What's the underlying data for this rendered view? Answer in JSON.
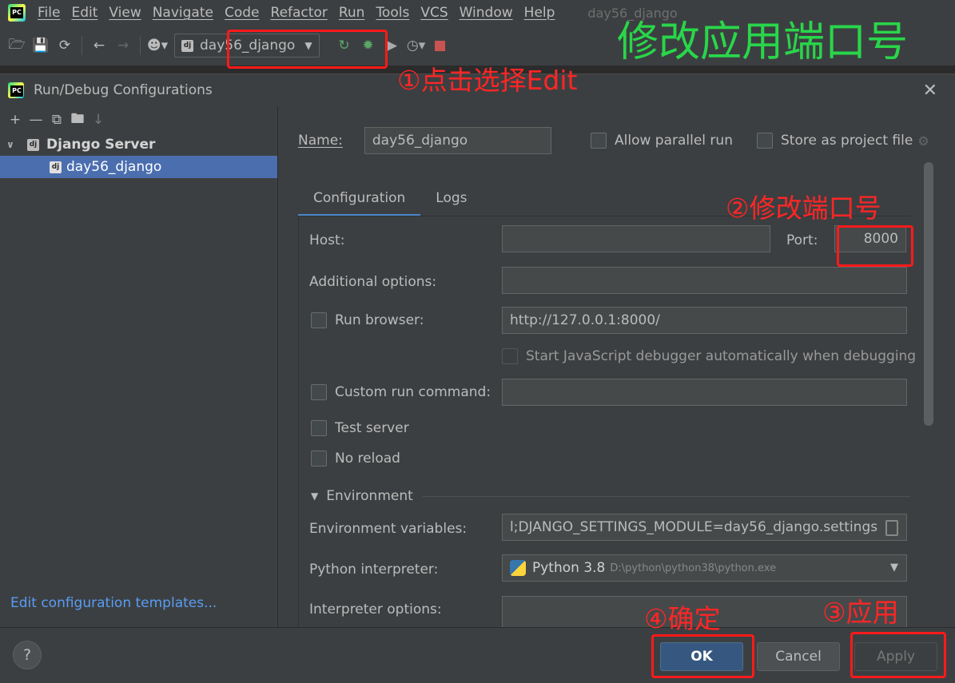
{
  "ide": {
    "menu": [
      "File",
      "Edit",
      "View",
      "Navigate",
      "Code",
      "Refactor",
      "Run",
      "Tools",
      "VCS",
      "Window",
      "Help"
    ],
    "window_title": "day56_django",
    "run_config_name": "day56_django"
  },
  "annotations": {
    "headline": "修改应用端口号",
    "step1": "①点击选择Edit",
    "step2": "②修改端口号",
    "step3": "③应用",
    "step4": "④确定",
    "color": "#ff1a1a",
    "headline_color": "#29d64a"
  },
  "dialog": {
    "title": "Run/Debug Configurations",
    "tree": {
      "group_label": "Django Server",
      "item_label": "day56_django"
    },
    "templates_link": "Edit configuration templates...",
    "name_label": "Name:",
    "name_value": "day56_django",
    "allow_parallel": "Allow parallel run",
    "store_as_project_file": "Store as project file",
    "tabs": [
      "Configuration",
      "Logs"
    ],
    "host_label": "Host:",
    "host_value": "",
    "port_label": "Port:",
    "port_value": "8000",
    "additional_options_label": "Additional options:",
    "additional_options_value": "",
    "run_browser_label": "Run browser:",
    "run_browser_url": "http://127.0.0.1:8000/",
    "js_debugger_label": "Start JavaScript debugger automatically when debugging",
    "custom_run_command_label": "Custom run command:",
    "custom_run_command_value": "",
    "test_server_label": "Test server",
    "no_reload_label": "No reload",
    "environment_label": "Environment",
    "env_vars_label": "Environment variables:",
    "env_vars_value": "l;DJANGO_SETTINGS_MODULE=day56_django.settings",
    "interpreter_label": "Python interpreter:",
    "interpreter_name": "Python 3.8",
    "interpreter_path": "D:\\python\\python38\\python.exe",
    "interpreter_options_label": "Interpreter options:",
    "buttons": {
      "help": "?",
      "ok": "OK",
      "cancel": "Cancel",
      "apply": "Apply"
    }
  }
}
